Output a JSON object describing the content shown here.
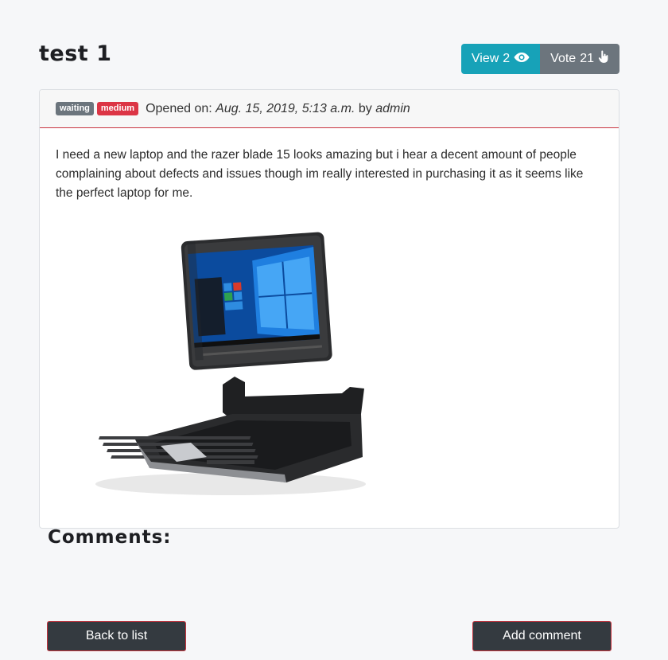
{
  "ticket": {
    "title": "test 1",
    "status_badge": "waiting",
    "priority_badge": "medium",
    "opened_label": "Opened on:",
    "opened_date": "Aug. 15, 2019, 5:13 a.m.",
    "by_label": "by",
    "author": "admin",
    "description": "I need a new laptop and the razer blade 15 looks amazing but i hear a decent amount of people complaining about defects and issues though im really interested in purchasing it as it seems like the perfect laptop for me."
  },
  "actions": {
    "view_label": "View",
    "view_count": "2",
    "vote_label": "Vote",
    "vote_count": "21"
  },
  "comments": {
    "title": "Comments:"
  },
  "footer": {
    "back_label": "Back to list",
    "add_comment_label": "Add comment"
  },
  "icons": {
    "view": "eye-icon",
    "vote": "hand-pointer-icon"
  },
  "colors": {
    "view_button": "#17a2b8",
    "vote_button": "#6c757d",
    "badge_waiting": "#6c757d",
    "badge_medium": "#dc3545",
    "accent_border": "#c9343f",
    "dark_button": "#343a40"
  }
}
